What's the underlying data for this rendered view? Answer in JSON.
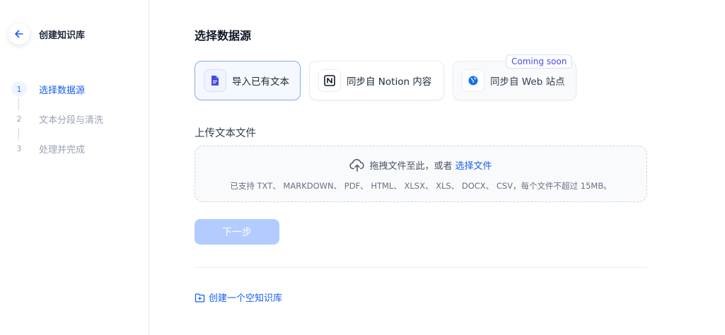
{
  "sidebar": {
    "title": "创建知识库",
    "steps": [
      {
        "num": "1",
        "label": "选择数据源"
      },
      {
        "num": "2",
        "label": "文本分段与清洗"
      },
      {
        "num": "3",
        "label": "处理并完成"
      }
    ]
  },
  "main": {
    "title": "选择数据源",
    "sources": [
      {
        "label": "导入已有文本",
        "icon": "document-icon"
      },
      {
        "label": "同步自 Notion 内容",
        "icon": "notion-icon"
      },
      {
        "label": "同步自 Web 站点",
        "icon": "web-icon"
      }
    ],
    "coming_soon": "Coming soon",
    "upload_title": "上传文本文件",
    "dropzone": {
      "text": "拖拽文件至此，或者",
      "link": "选择文件",
      "hint": "已支持 TXT、 MARKDOWN、 PDF、 HTML、 XLSX、 XLS、 DOCX、 CSV，每个文件不超过 15MB。"
    },
    "next_button": "下一步",
    "create_empty": "创建一个空知识库"
  },
  "colors": {
    "accent": "#155eef",
    "disabled_button": "#b2ccff"
  }
}
